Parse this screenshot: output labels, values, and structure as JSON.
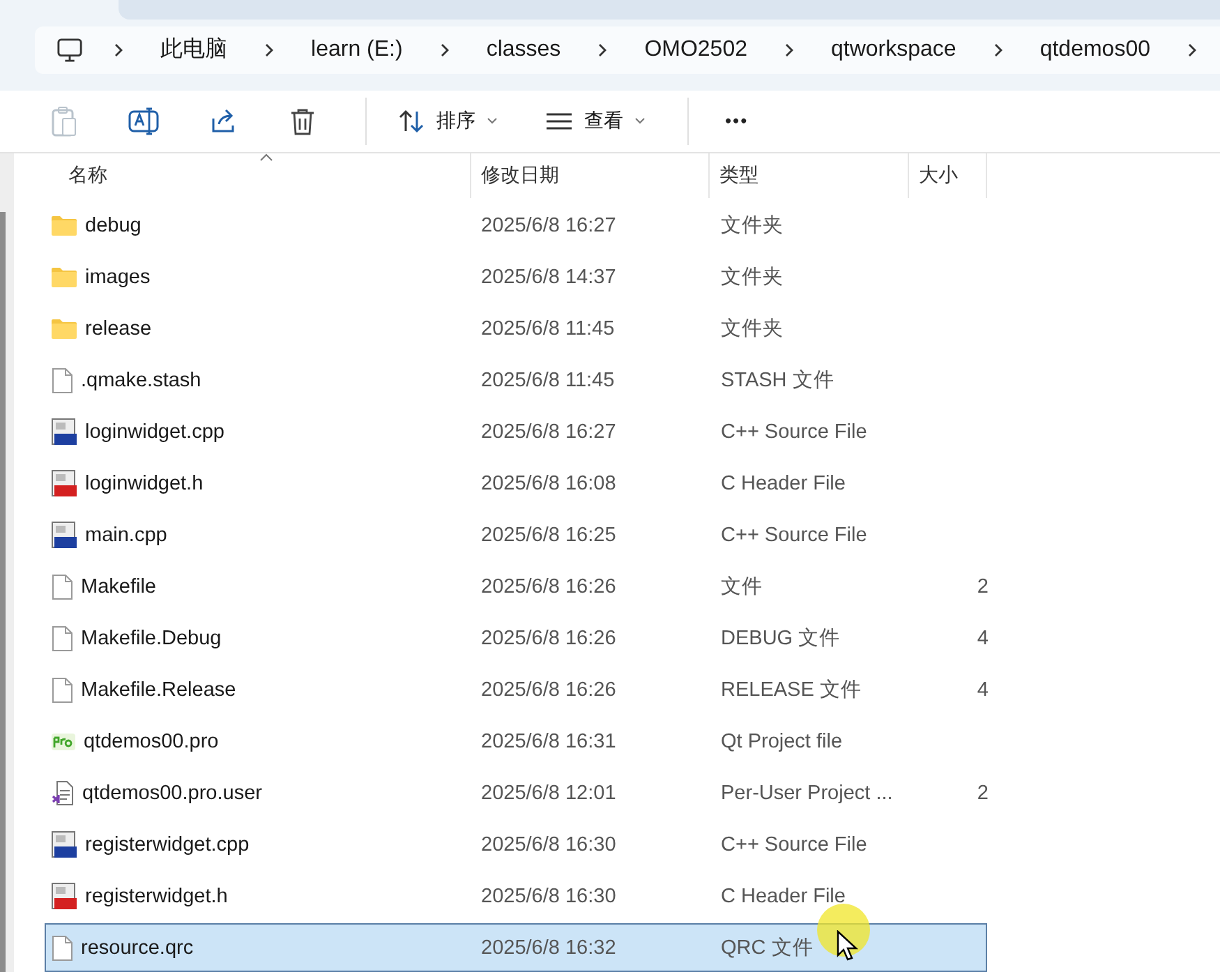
{
  "breadcrumb": [
    "此电脑",
    "learn (E:)",
    "classes",
    "OMO2502",
    "qtworkspace",
    "qtdemos00"
  ],
  "toolbar": {
    "sort": "排序",
    "view": "查看",
    "more": "•••"
  },
  "columns": [
    "名称",
    "修改日期",
    "类型",
    "大小"
  ],
  "rows": [
    {
      "kind": "folder",
      "name": "debug",
      "date": "2025/6/8 16:27",
      "type": "文件夹",
      "selected": false
    },
    {
      "kind": "folder",
      "name": "images",
      "date": "2025/6/8 14:37",
      "type": "文件夹",
      "selected": false
    },
    {
      "kind": "folder",
      "name": "release",
      "date": "2025/6/8 11:45",
      "type": "文件夹",
      "selected": false
    },
    {
      "kind": "file",
      "name": ".qmake.stash",
      "date": "2025/6/8 11:45",
      "type": "STASH 文件",
      "selected": false
    },
    {
      "kind": "cpp",
      "name": "loginwidget.cpp",
      "date": "2025/6/8 16:27",
      "type": "C++ Source File",
      "selected": false
    },
    {
      "kind": "header",
      "name": "loginwidget.h",
      "date": "2025/6/8 16:08",
      "type": "C Header File",
      "selected": false
    },
    {
      "kind": "cpp",
      "name": "main.cpp",
      "date": "2025/6/8 16:25",
      "type": "C++ Source File",
      "selected": false
    },
    {
      "kind": "file",
      "name": "Makefile",
      "date": "2025/6/8 16:26",
      "type": "文件",
      "size": "2",
      "selected": false
    },
    {
      "kind": "file",
      "name": "Makefile.Debug",
      "date": "2025/6/8 16:26",
      "type": "DEBUG 文件",
      "size": "4",
      "selected": false
    },
    {
      "kind": "file",
      "name": "Makefile.Release",
      "date": "2025/6/8 16:26",
      "type": "RELEASE 文件",
      "size": "4",
      "selected": false
    },
    {
      "kind": "pro",
      "name": "qtdemos00.pro",
      "date": "2025/6/8 16:31",
      "type": "Qt Project file",
      "selected": false
    },
    {
      "kind": "user",
      "name": "qtdemos00.pro.user",
      "date": "2025/6/8 12:01",
      "type": "Per-User Project ...",
      "size": "2",
      "selected": false
    },
    {
      "kind": "cpp",
      "name": "registerwidget.cpp",
      "date": "2025/6/8 16:30",
      "type": "C++ Source File",
      "selected": false
    },
    {
      "kind": "header",
      "name": "registerwidget.h",
      "date": "2025/6/8 16:30",
      "type": "C Header File",
      "selected": false
    },
    {
      "kind": "file",
      "name": "resource.qrc",
      "date": "2025/6/8 16:32",
      "type": "QRC 文件",
      "selected": true
    }
  ]
}
